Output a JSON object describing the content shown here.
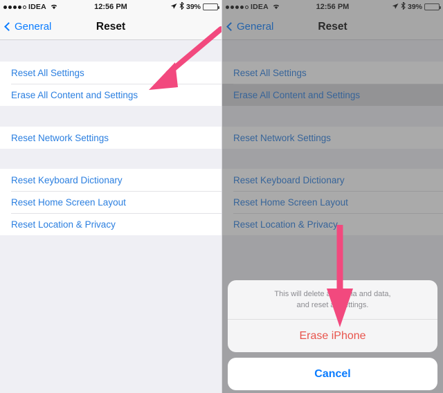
{
  "colors": {
    "accent_pink": "#f2497e",
    "link_blue": "#2b7fe0",
    "nav_blue": "#0a7cff",
    "destructive_red": "#e8544c",
    "battery_green": "#4cd445",
    "table_bg": "#efeff4",
    "selected_row": "#d4d4d8"
  },
  "status_bar": {
    "carrier": "IDEA",
    "signal_dots_filled": 4,
    "signal_dots_empty": 1,
    "wifi_icon": "wifi-icon",
    "time": "12:56 PM",
    "location_icon": "location-arrow-icon",
    "bluetooth_icon": "bluetooth-icon",
    "battery_percent": "39%",
    "battery_icon": "battery-icon",
    "battery_level": 39
  },
  "nav": {
    "back_label": "General",
    "back_icon": "chevron-left-icon",
    "title": "Reset"
  },
  "reset_list": {
    "sections": [
      {
        "rows": [
          {
            "label": "Reset All Settings",
            "name": "reset-all-settings"
          },
          {
            "label": "Erase All Content and Settings",
            "name": "erase-all-content-and-settings"
          }
        ]
      },
      {
        "rows": [
          {
            "label": "Reset Network Settings",
            "name": "reset-network-settings"
          }
        ]
      },
      {
        "rows": [
          {
            "label": "Reset Keyboard Dictionary",
            "name": "reset-keyboard-dictionary"
          },
          {
            "label": "Reset Home Screen Layout",
            "name": "reset-home-screen-layout"
          },
          {
            "label": "Reset Location & Privacy",
            "name": "reset-location-and-privacy"
          }
        ]
      }
    ]
  },
  "action_sheet": {
    "message_line1": "This will delete all media and data,",
    "message_line2": "and reset all settings.",
    "destructive_label": "Erase iPhone",
    "cancel_label": "Cancel"
  },
  "annotations": {
    "left_arrow": {
      "name": "pink-arrow-pointing-to-erase-all-content",
      "direction": "down-left",
      "target": "Erase All Content and Settings"
    },
    "right_arrow": {
      "name": "pink-arrow-pointing-to-erase-iphone",
      "direction": "down",
      "target": "Erase iPhone"
    }
  }
}
